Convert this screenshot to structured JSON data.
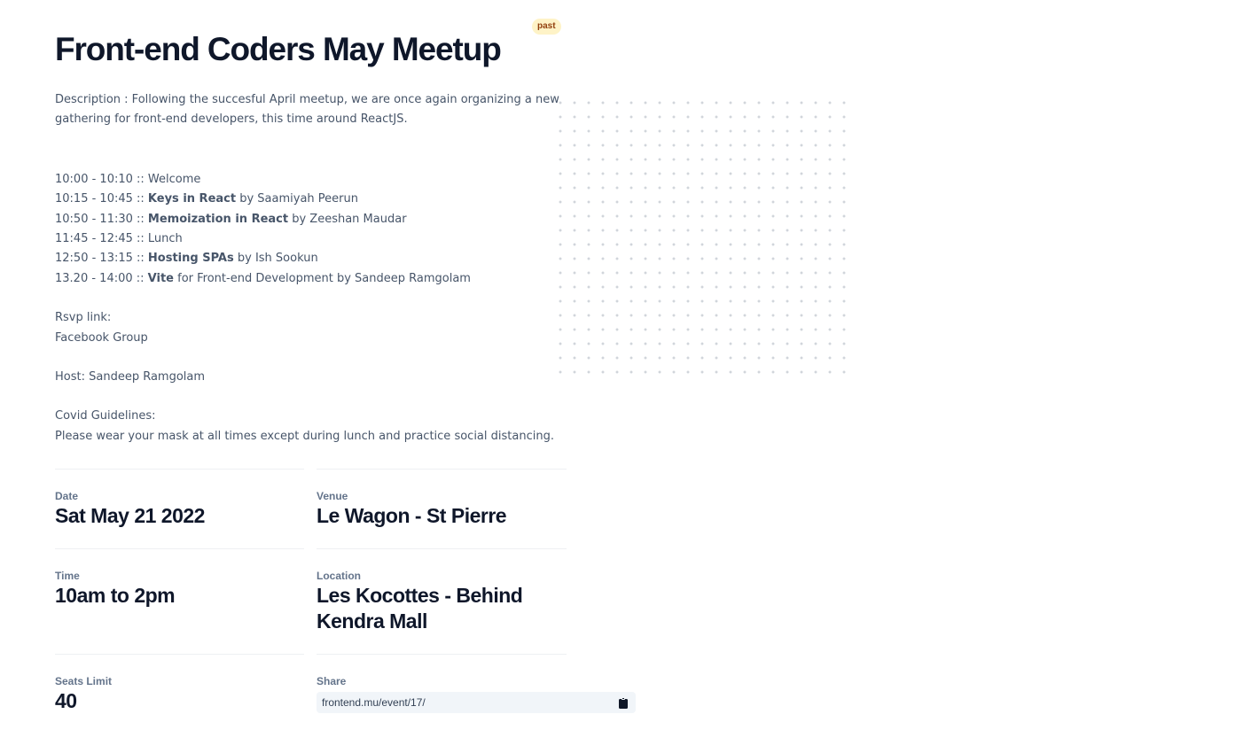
{
  "event": {
    "title": "Front-end Coders May Meetup",
    "badge": "past"
  },
  "description": {
    "intro": "Description : Following the succesful April meetup, we are once again organizing a new gathering for front-end developers, this time around ReactJS.",
    "schedule": [
      {
        "time": "10:00 - 10:10 :: ",
        "bold": "",
        "rest": "Welcome"
      },
      {
        "time": "10:15 - 10:45 :: ",
        "bold": "Keys in React",
        "rest": " by Saamiyah Peerun"
      },
      {
        "time": "10:50 - 11:30 :: ",
        "bold": "Memoization in React",
        "rest": " by Zeeshan Maudar"
      },
      {
        "time": "11:45 - 12:45 :: ",
        "bold": "",
        "rest": "Lunch"
      },
      {
        "time": "12:50 - 13:15 :: ",
        "bold": "Hosting SPAs",
        "rest": " by Ish Sookun"
      },
      {
        "time": "13.20 - 14:00 :: ",
        "bold": "Vite",
        "rest": " for Front-end Development by Sandeep Ramgolam"
      }
    ],
    "rsvp_label": "Rsvp link:",
    "rsvp_link": "Facebook Group",
    "host": "Host: Sandeep Ramgolam",
    "covid_label": "Covid Guidelines:",
    "covid_text": "Please wear your mask at all times except during lunch and practice social distancing."
  },
  "details": {
    "date_label": "Date",
    "date_value": "Sat May 21 2022",
    "venue_label": "Venue",
    "venue_value": "Le Wagon - St Pierre",
    "time_label": "Time",
    "time_value": "10am to 2pm",
    "location_label": "Location",
    "location_value": "Les Kocottes - Behind Kendra Mall",
    "seats_label": "Seats Limit",
    "seats_value": "40",
    "share_label": "Share",
    "share_url": "frontend.mu/event/17/"
  },
  "icons": {
    "copy": "clipboard-icon"
  },
  "colors": {
    "title": "#0f172a",
    "body_text": "#475569",
    "badge_bg": "#fef3c7",
    "badge_text": "#92400e"
  }
}
